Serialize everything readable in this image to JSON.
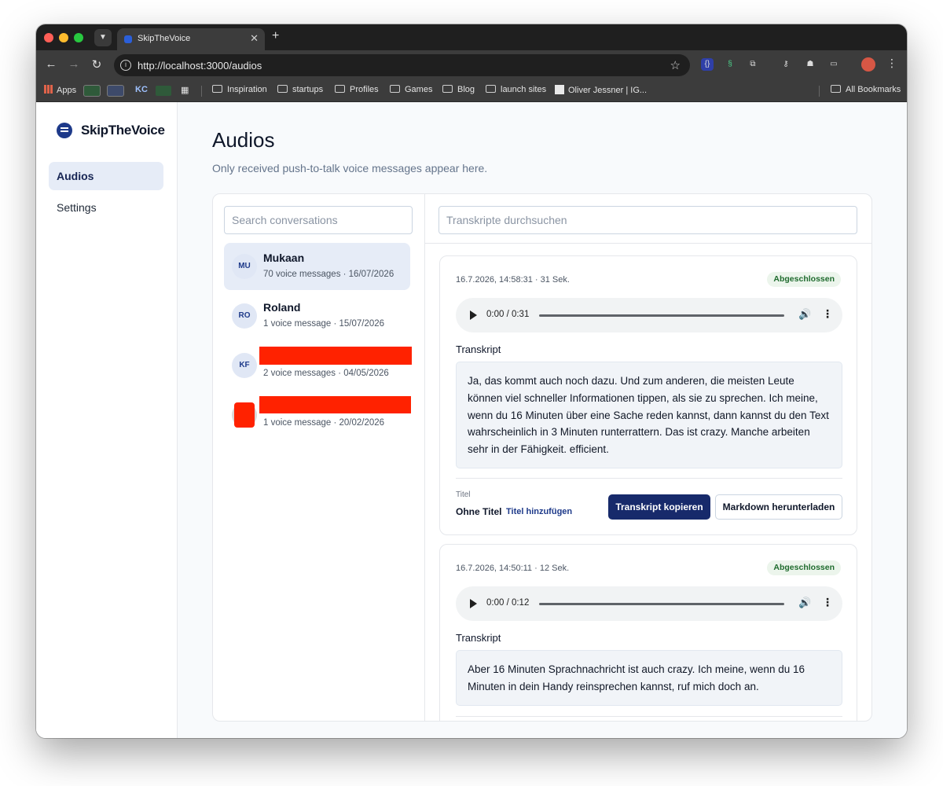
{
  "browser": {
    "tab_title": "SkipTheVoice",
    "new_tab_symbol": "+",
    "url": "http://localhost:3000/audios",
    "bookmarks": {
      "apps": "Apps",
      "kc": "KC",
      "folders": [
        "Inspiration",
        "startups",
        "Profiles",
        "Games",
        "Blog",
        "launch sites"
      ],
      "oliver": "Oliver Jessner | IG...",
      "all": "All Bookmarks"
    }
  },
  "sidebar": {
    "brand": "SkipTheVoice",
    "items": [
      {
        "label": "Audios",
        "active": true
      },
      {
        "label": "Settings",
        "active": false
      }
    ]
  },
  "page": {
    "title": "Audios",
    "subtitle": "Only received push-to-talk voice messages appear here."
  },
  "conversations": {
    "search_placeholder": "Search conversations",
    "items": [
      {
        "initials": "MU",
        "name": "Mukaan",
        "meta": "70 voice messages · 16/07/2026",
        "active": true
      },
      {
        "initials": "RO",
        "name": "Roland",
        "meta": "1 voice message · 15/07/2026",
        "active": false
      },
      {
        "initials": "KF",
        "name": "",
        "meta": "2 voice messages · 04/05/2026",
        "active": false
      },
      {
        "initials": "",
        "name": "",
        "meta": "1 voice message · 20/02/2026",
        "active": false
      }
    ]
  },
  "transcripts": {
    "search_placeholder": "Transkripte durchsuchen",
    "cards": [
      {
        "meta": "16.7.2026, 14:58:31 · 31 Sek.",
        "status": "Abgeschlossen",
        "player_time": "0:00 / 0:31",
        "label": "Transkript",
        "text": "Ja, das kommt auch noch dazu. Und zum anderen, die meisten Leute können viel schneller Informationen tippen, als sie zu sprechen. Ich meine, wenn du 16 Minuten über eine Sache reden kannst, dann kannst du den Text wahrscheinlich in 3 Minuten runterrattern. Das ist crazy. Manche arbeiten sehr in der Fähigkeit. efficient.",
        "title_label": "Titel",
        "title_value": "Ohne Titel",
        "title_add": "Titel hinzufügen",
        "copy_button": "Transkript kopieren",
        "download_button": "Markdown herunterladen"
      },
      {
        "meta": "16.7.2026, 14:50:11 · 12 Sek.",
        "status": "Abgeschlossen",
        "player_time": "0:00 / 0:12",
        "label": "Transkript",
        "text": "Aber 16 Minuten Sprachnachricht ist auch crazy. Ich meine, wenn du 16 Minuten in dein Handy reinsprechen kannst, ruf mich doch an."
      }
    ]
  },
  "colors": {
    "accent": "#172a6b",
    "active_bg": "#e6ecf7",
    "badge_bg": "#ecf5ec",
    "badge_text": "#1f6b2e",
    "redaction": "#ff2200"
  }
}
